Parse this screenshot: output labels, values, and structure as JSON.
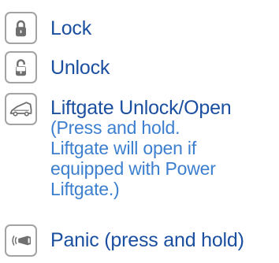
{
  "colors": {
    "label": "#1b4fa0",
    "description": "#3c7fcf",
    "icon_border": "#a3a3a3",
    "icon_glyph": "#6f6f6f"
  },
  "buttons": [
    {
      "icon": "lock-icon",
      "label": "Lock"
    },
    {
      "icon": "unlock-icon",
      "label": "Unlock"
    },
    {
      "icon": "liftgate-icon",
      "label": "Liftgate Unlock/Open",
      "description_lines": [
        "(Press and hold.",
        "Liftgate will open if",
        "equipped with Power",
        "Liftgate.)"
      ]
    },
    {
      "icon": "panic-horn-icon",
      "label": "Panic (press and hold)"
    }
  ]
}
